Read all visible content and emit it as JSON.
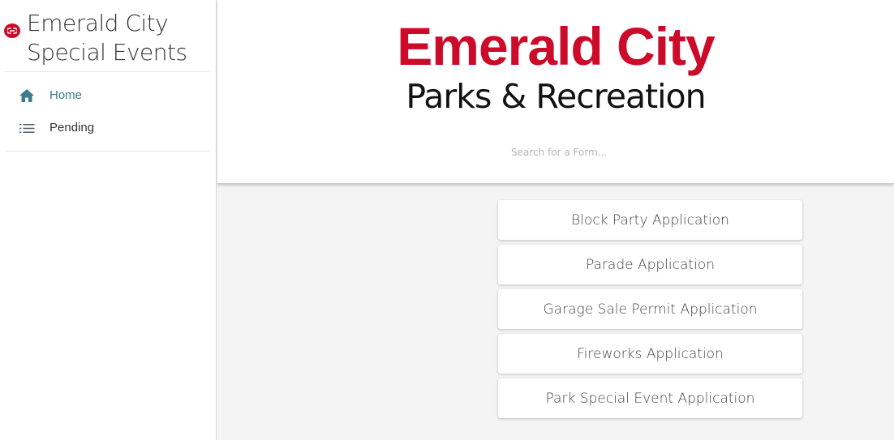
{
  "sidebar": {
    "brand_line1": "Emerald City",
    "brand_line2": "Special Events",
    "logo_icon": "city-seal-icon",
    "items": [
      {
        "label": "Home",
        "icon": "home-icon",
        "active": true
      },
      {
        "label": "Pending",
        "icon": "list-icon",
        "active": false
      }
    ]
  },
  "header": {
    "logo_main": "Emerald City",
    "logo_sub": "Parks & Recreation",
    "search_placeholder": "Search for a Form...",
    "search_value": ""
  },
  "forms": [
    {
      "label": "Block Party Application"
    },
    {
      "label": "Parade Application"
    },
    {
      "label": "Garage Sale Permit Application"
    },
    {
      "label": "Fireworks Application"
    },
    {
      "label": "Park Special Event Application"
    }
  ],
  "colors": {
    "brand_red": "#cc0b2a",
    "active_teal": "#3a7b8c",
    "icon_gray": "#5a6770",
    "page_background": "#f4f4f4"
  }
}
